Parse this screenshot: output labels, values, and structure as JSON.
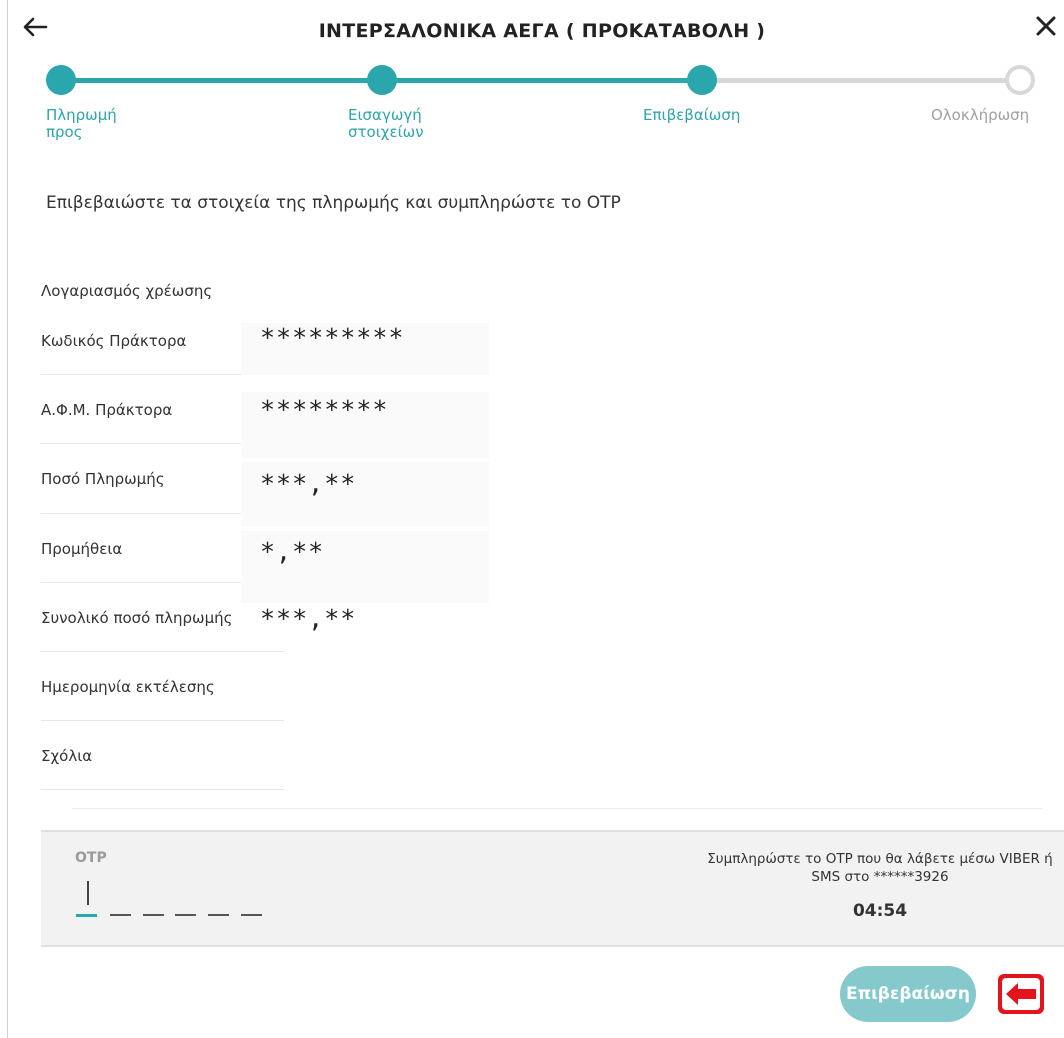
{
  "header": {
    "title": "ΙΝΤΕΡΣΑΛΟΝΙΚΑ ΑΕΓΑ ( ΠΡΟΚΑΤΑΒΟΛΗ )",
    "back_icon": "arrow-left-icon",
    "close_icon": "close-icon"
  },
  "stepper": {
    "steps": [
      {
        "label": "Πληρωμή\nπρος",
        "state": "done"
      },
      {
        "label": "Εισαγωγή\nστοιχείων",
        "state": "done"
      },
      {
        "label": "Επιβεβαίωση",
        "state": "current"
      },
      {
        "label": "Ολοκλήρωση",
        "state": "todo"
      }
    ],
    "accent_color": "#2aa6ad"
  },
  "instruction": "Επιβεβαιώστε τα στοιχεία της πληρωμής και συμπληρώστε το OTP",
  "details": {
    "rows": [
      {
        "label": "Λογαριασμός χρέωσης",
        "value": ""
      },
      {
        "label": "Κωδικός Πράκτορα",
        "value": "*********"
      },
      {
        "label": "Α.Φ.Μ. Πράκτορα",
        "value": "********"
      },
      {
        "label": "Ποσό Πληρωμής",
        "value": "***,**"
      },
      {
        "label": "Προμήθεια",
        "value": "*,**"
      },
      {
        "label": "Συνολικό ποσό πληρωμής",
        "value": "***,**"
      },
      {
        "label": "Ημερομηνία εκτέλεσης",
        "value": ""
      },
      {
        "label": "Σχόλια",
        "value": ""
      }
    ]
  },
  "otp": {
    "label": "OTP",
    "value": "",
    "length": 6,
    "help_text": "Συμπληρώστε το OTP που θα λάβετε μέσω VIBER ή SMS στο ******3926",
    "timer": "04:54"
  },
  "actions": {
    "confirm_label": "Επιβεβαίωση",
    "confirm_color": "#86c9cd",
    "back_icon": "red-arrow-left-icon",
    "back_color": "#e3141b"
  }
}
